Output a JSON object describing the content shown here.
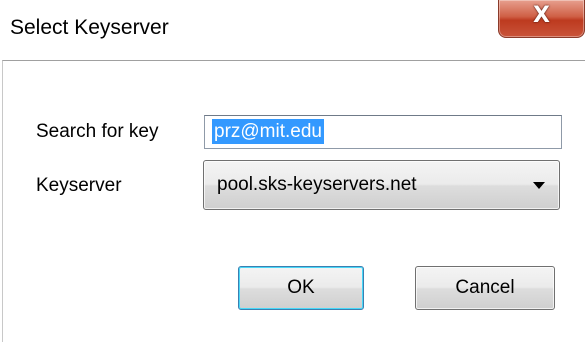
{
  "window": {
    "title": "Select Keyserver",
    "close_label": "X"
  },
  "form": {
    "search_label": "Search for key",
    "search_value": "prz@mit.edu",
    "keyserver_label": "Keyserver",
    "keyserver_selected": "pool.sks-keyservers.net"
  },
  "buttons": {
    "ok_label": "OK",
    "cancel_label": "Cancel"
  },
  "colors": {
    "selection": "#3399ff",
    "close_button": "#c9543a"
  }
}
